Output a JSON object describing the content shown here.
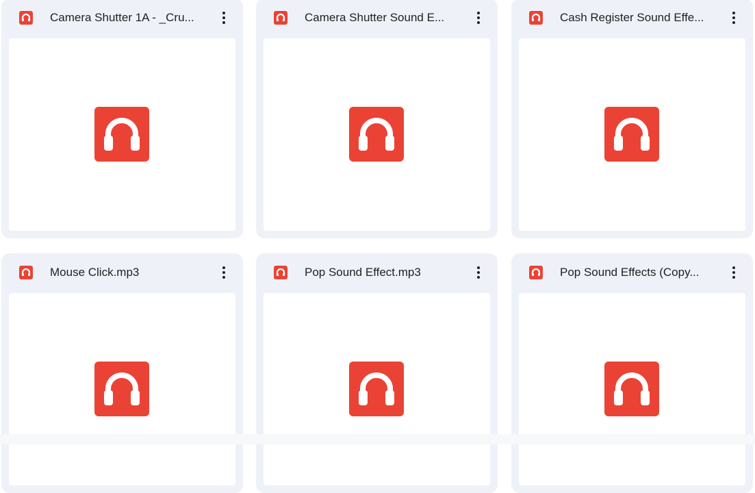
{
  "colors": {
    "card_bg": "#eef2f8",
    "preview_bg": "#ffffff",
    "audio_icon": "#ea4335",
    "text": "#1f1f1f"
  },
  "files": [
    {
      "name": "Camera Shutter 1A - _Cru...",
      "icon": "headphones-icon"
    },
    {
      "name": "Camera Shutter Sound E...",
      "icon": "headphones-icon"
    },
    {
      "name": "Cash Register Sound Effe...",
      "icon": "headphones-icon"
    },
    {
      "name": "Mouse Click.mp3",
      "icon": "headphones-icon"
    },
    {
      "name": "Pop Sound Effect.mp3",
      "icon": "headphones-icon"
    },
    {
      "name": "Pop Sound Effects (Copy...",
      "icon": "headphones-icon"
    }
  ]
}
